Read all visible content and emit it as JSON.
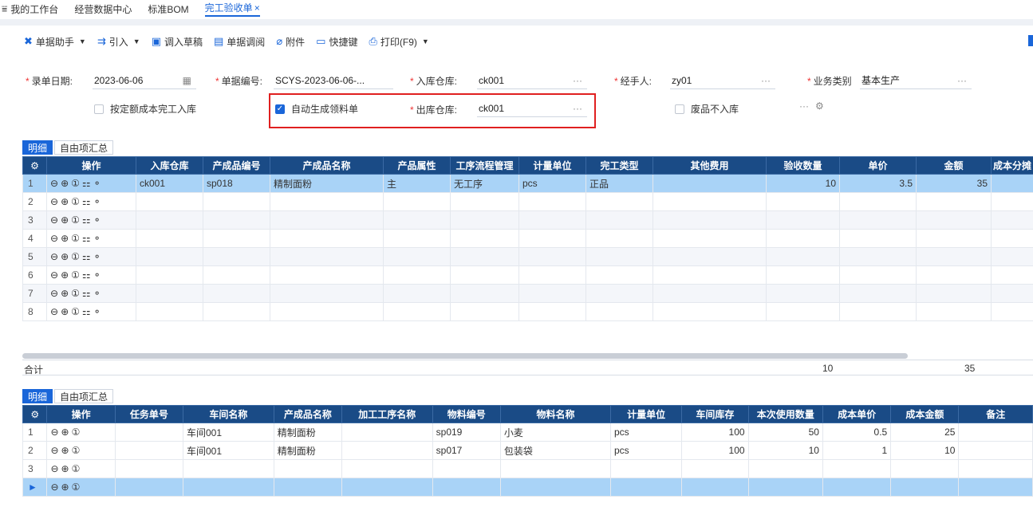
{
  "tabs": [
    {
      "label": "我的工作台"
    },
    {
      "label": "经营数据中心"
    },
    {
      "label": "标准BOM"
    },
    {
      "label": "完工验收单"
    }
  ],
  "tab_close": "×",
  "toolbar": {
    "assistant": "单据助手",
    "import": "引入",
    "draft": "调入草稿",
    "review": "单据调阅",
    "attachment": "附件",
    "shortcut": "快捷键",
    "print": "打印(F9)"
  },
  "form": {
    "date_label": "录单日期:",
    "date_value": "2023-06-06",
    "docno_label": "单据编号:",
    "docno_value": "SCYS-2023-06-06-...",
    "in_wh_label": "入库仓库:",
    "in_wh_value": "ck001",
    "handler_label": "经手人:",
    "handler_value": "zy01",
    "biz_label": "业务类别",
    "biz_value": "基本生产",
    "quota_label": "按定额成本完工入库",
    "auto_label": "自动生成领料单",
    "out_wh_label": "出库仓库:",
    "out_wh_value": "ck001",
    "waste_label": "废品不入库",
    "dots": "···"
  },
  "subtabs": {
    "detail": "明细",
    "summary": "自由项汇总"
  },
  "table1": {
    "headers": [
      "操作",
      "入库仓库",
      "产成品编号",
      "产成品名称",
      "产品属性",
      "工序流程管理",
      "计量单位",
      "完工类型",
      "其他费用",
      "验收数量",
      "单价",
      "金额",
      "成本分摊"
    ],
    "rows": [
      {
        "idx": "1",
        "wh": "ck001",
        "code": "sp018",
        "name": "精制面粉",
        "attr": "主",
        "proc": "无工序",
        "unit": "pcs",
        "type": "正品",
        "other": "",
        "qty": "10",
        "price": "3.5",
        "amt": "35",
        "cost": ""
      },
      {
        "idx": "2",
        "wh": "",
        "code": "",
        "name": "",
        "attr": "",
        "proc": "",
        "unit": "",
        "type": "",
        "other": "",
        "qty": "",
        "price": "",
        "amt": "",
        "cost": ""
      },
      {
        "idx": "3",
        "wh": "",
        "code": "",
        "name": "",
        "attr": "",
        "proc": "",
        "unit": "",
        "type": "",
        "other": "",
        "qty": "",
        "price": "",
        "amt": "",
        "cost": ""
      },
      {
        "idx": "4",
        "wh": "",
        "code": "",
        "name": "",
        "attr": "",
        "proc": "",
        "unit": "",
        "type": "",
        "other": "",
        "qty": "",
        "price": "",
        "amt": "",
        "cost": ""
      },
      {
        "idx": "5",
        "wh": "",
        "code": "",
        "name": "",
        "attr": "",
        "proc": "",
        "unit": "",
        "type": "",
        "other": "",
        "qty": "",
        "price": "",
        "amt": "",
        "cost": ""
      },
      {
        "idx": "6",
        "wh": "",
        "code": "",
        "name": "",
        "attr": "",
        "proc": "",
        "unit": "",
        "type": "",
        "other": "",
        "qty": "",
        "price": "",
        "amt": "",
        "cost": ""
      },
      {
        "idx": "7",
        "wh": "",
        "code": "",
        "name": "",
        "attr": "",
        "proc": "",
        "unit": "",
        "type": "",
        "other": "",
        "qty": "",
        "price": "",
        "amt": "",
        "cost": ""
      },
      {
        "idx": "8",
        "wh": "",
        "code": "",
        "name": "",
        "attr": "",
        "proc": "",
        "unit": "",
        "type": "",
        "other": "",
        "qty": "",
        "price": "",
        "amt": "",
        "cost": ""
      }
    ],
    "sum_label": "合计",
    "sum_qty": "10",
    "sum_amt": "35"
  },
  "table2": {
    "headers": [
      "操作",
      "任务单号",
      "车间名称",
      "产成品名称",
      "加工工序名称",
      "物料编号",
      "物料名称",
      "计量单位",
      "车间库存",
      "本次使用数量",
      "成本单价",
      "成本金额",
      "备注"
    ],
    "rows": [
      {
        "idx": "1",
        "task": "",
        "shop": "车间001",
        "prod": "精制面粉",
        "step": "",
        "mcode": "sp019",
        "mname": "小麦",
        "unit": "pcs",
        "stock": "100",
        "use": "50",
        "cprice": "0.5",
        "camt": "25",
        "note": ""
      },
      {
        "idx": "2",
        "task": "",
        "shop": "车间001",
        "prod": "精制面粉",
        "step": "",
        "mcode": "sp017",
        "mname": "包装袋",
        "unit": "pcs",
        "stock": "100",
        "use": "10",
        "cprice": "1",
        "camt": "10",
        "note": ""
      },
      {
        "idx": "3",
        "task": "",
        "shop": "",
        "prod": "",
        "step": "",
        "mcode": "",
        "mname": "",
        "unit": "",
        "stock": "",
        "use": "",
        "cprice": "",
        "camt": "",
        "note": ""
      },
      {
        "idx": "►",
        "task": "",
        "shop": "",
        "prod": "",
        "step": "",
        "mcode": "",
        "mname": "",
        "unit": "",
        "stock": "",
        "use": "",
        "cprice": "",
        "camt": "",
        "note": ""
      }
    ]
  },
  "colors": {
    "accent": "#1a66d9",
    "header": "#1a4b86",
    "selected": "#a9d3f7",
    "highlight": "#e02020"
  }
}
